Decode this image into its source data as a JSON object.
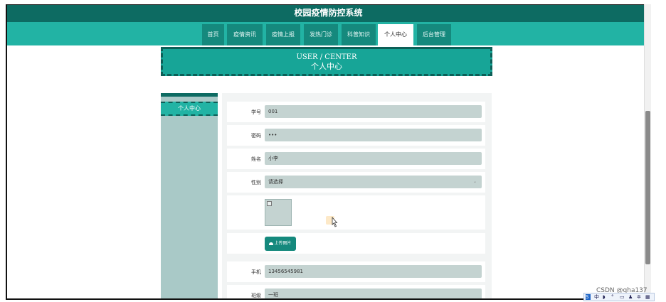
{
  "app": {
    "title": "校园疫情防控系统"
  },
  "nav": {
    "items": [
      {
        "label": "首页",
        "active": false
      },
      {
        "label": "疫情资讯",
        "active": false
      },
      {
        "label": "疫情上报",
        "active": false
      },
      {
        "label": "发热门诊",
        "active": false
      },
      {
        "label": "科普知识",
        "active": false
      },
      {
        "label": "个人中心",
        "active": true
      },
      {
        "label": "后台管理",
        "active": false
      }
    ]
  },
  "banner": {
    "en": "USER / CENTER",
    "cn": "个人中心"
  },
  "sidebar": {
    "items": [
      {
        "label": "个人中心"
      }
    ]
  },
  "form": {
    "student_id": {
      "label": "学号",
      "value": "001"
    },
    "password": {
      "label": "密码",
      "value": "•••"
    },
    "name": {
      "label": "姓名",
      "value": "小李"
    },
    "gender": {
      "label": "性别",
      "value": "请选择"
    },
    "upload_button": {
      "label": "上传图片"
    },
    "phone": {
      "label": "手机",
      "value": "13456545981"
    },
    "class": {
      "label": "班级",
      "value": "一班"
    }
  },
  "watermark": "CSDN @qha137",
  "colors": {
    "header": "#0d6b62",
    "nav": "#22b3a4",
    "accent": "#15897d",
    "field": "#c4d3d1"
  }
}
